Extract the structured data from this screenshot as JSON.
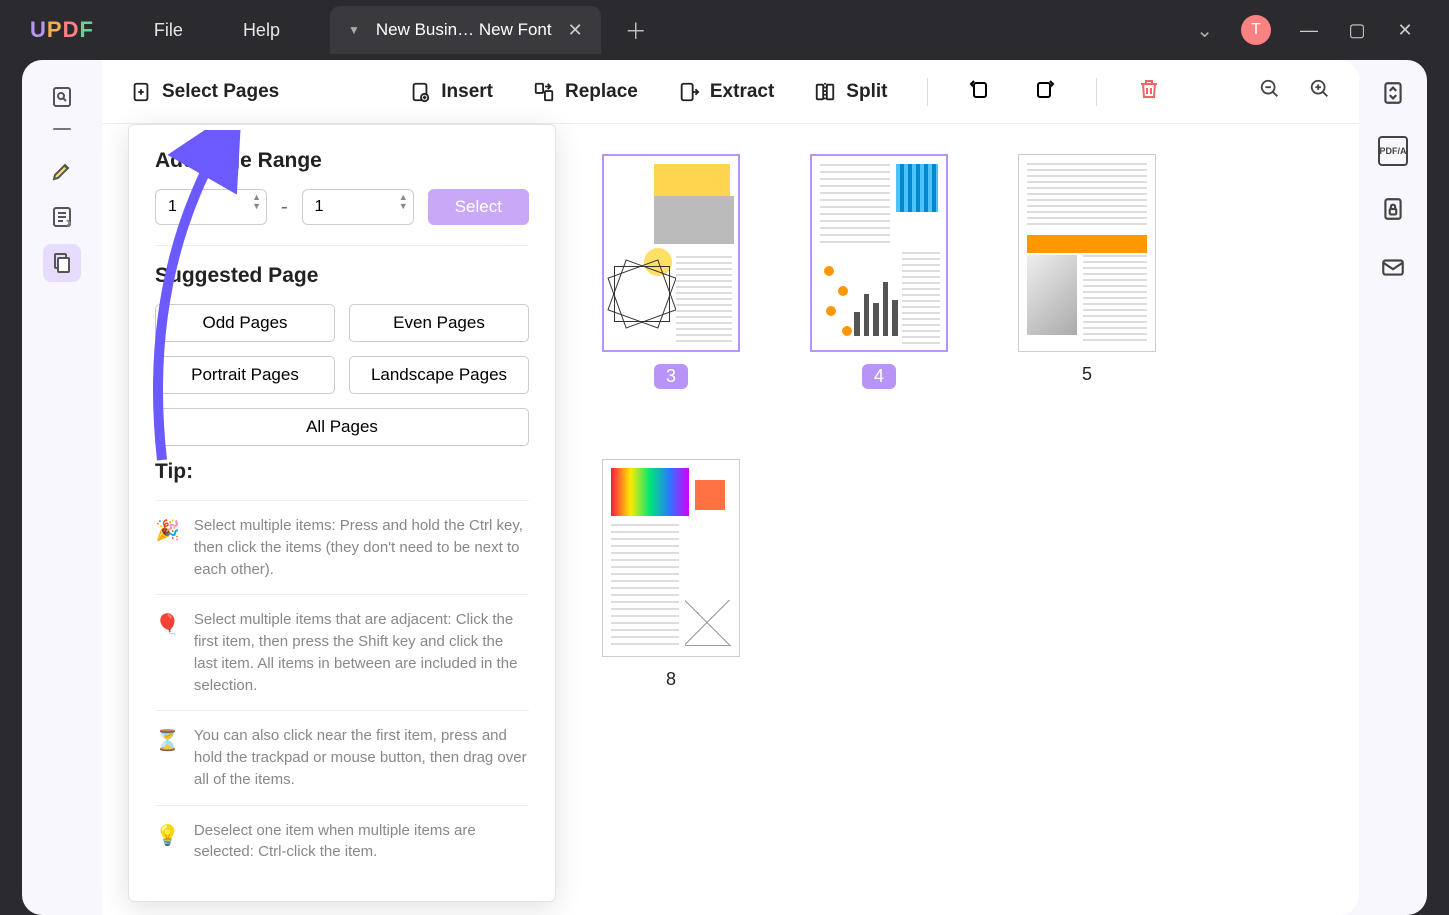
{
  "titlebar": {
    "menu_file": "File",
    "menu_help": "Help",
    "tab_title": "New Busin… New Font",
    "avatar_letter": "T"
  },
  "toolbar": {
    "select_pages": "Select Pages",
    "insert": "Insert",
    "replace": "Replace",
    "extract": "Extract",
    "split": "Split"
  },
  "popup": {
    "range_heading": "Add Page Range",
    "from_value": "1",
    "to_value": "1",
    "select_btn": "Select",
    "suggested_heading": "Suggested Page",
    "odd": "Odd Pages",
    "even": "Even Pages",
    "portrait": "Portrait Pages",
    "landscape": "Landscape Pages",
    "all": "All Pages",
    "tip_heading": "Tip:",
    "tips": [
      "Select multiple items: Press and hold the Ctrl key, then click the items (they don't need to be next to each other).",
      "Select multiple items that are adjacent: Click the first item, then press the Shift key and click the last item. All items in between are included in the selection.",
      "You can also click near the first item, press and hold the trackpad or mouse button, then drag over all of the items.",
      "Deselect one item when multiple items are selected: Ctrl-click the item."
    ]
  },
  "pages": {
    "p3": "3",
    "p4": "4",
    "p5": "5",
    "p8": "8"
  },
  "right": {
    "pdfa": "PDF/A"
  }
}
